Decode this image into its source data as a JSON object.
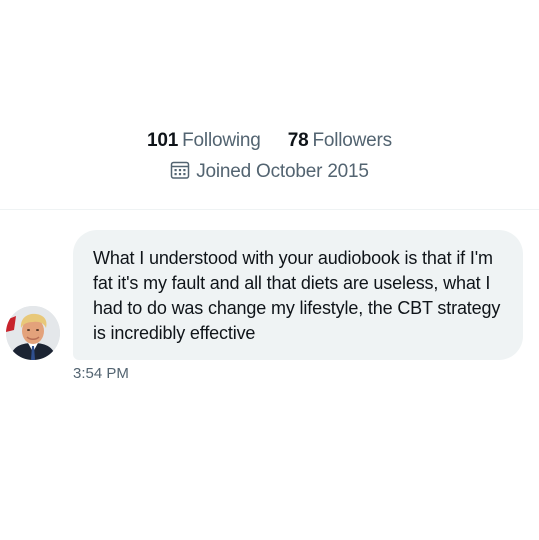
{
  "profile": {
    "following_count": "101",
    "following_label": "Following",
    "followers_count": "78",
    "followers_label": "Followers",
    "joined_text": "Joined October 2015",
    "joined_icon": "calendar-icon"
  },
  "conversation": {
    "message": {
      "text": "What I understood with your audiobook is that if I'm fat it's my fault and all that diets are useless, what I had to do was change my lifestyle, the CBT strategy is incredibly effective",
      "time": "3:54 PM"
    }
  },
  "colors": {
    "bubble_background": "#eff3f4",
    "text_primary": "#0f1419",
    "text_secondary": "#536471"
  }
}
